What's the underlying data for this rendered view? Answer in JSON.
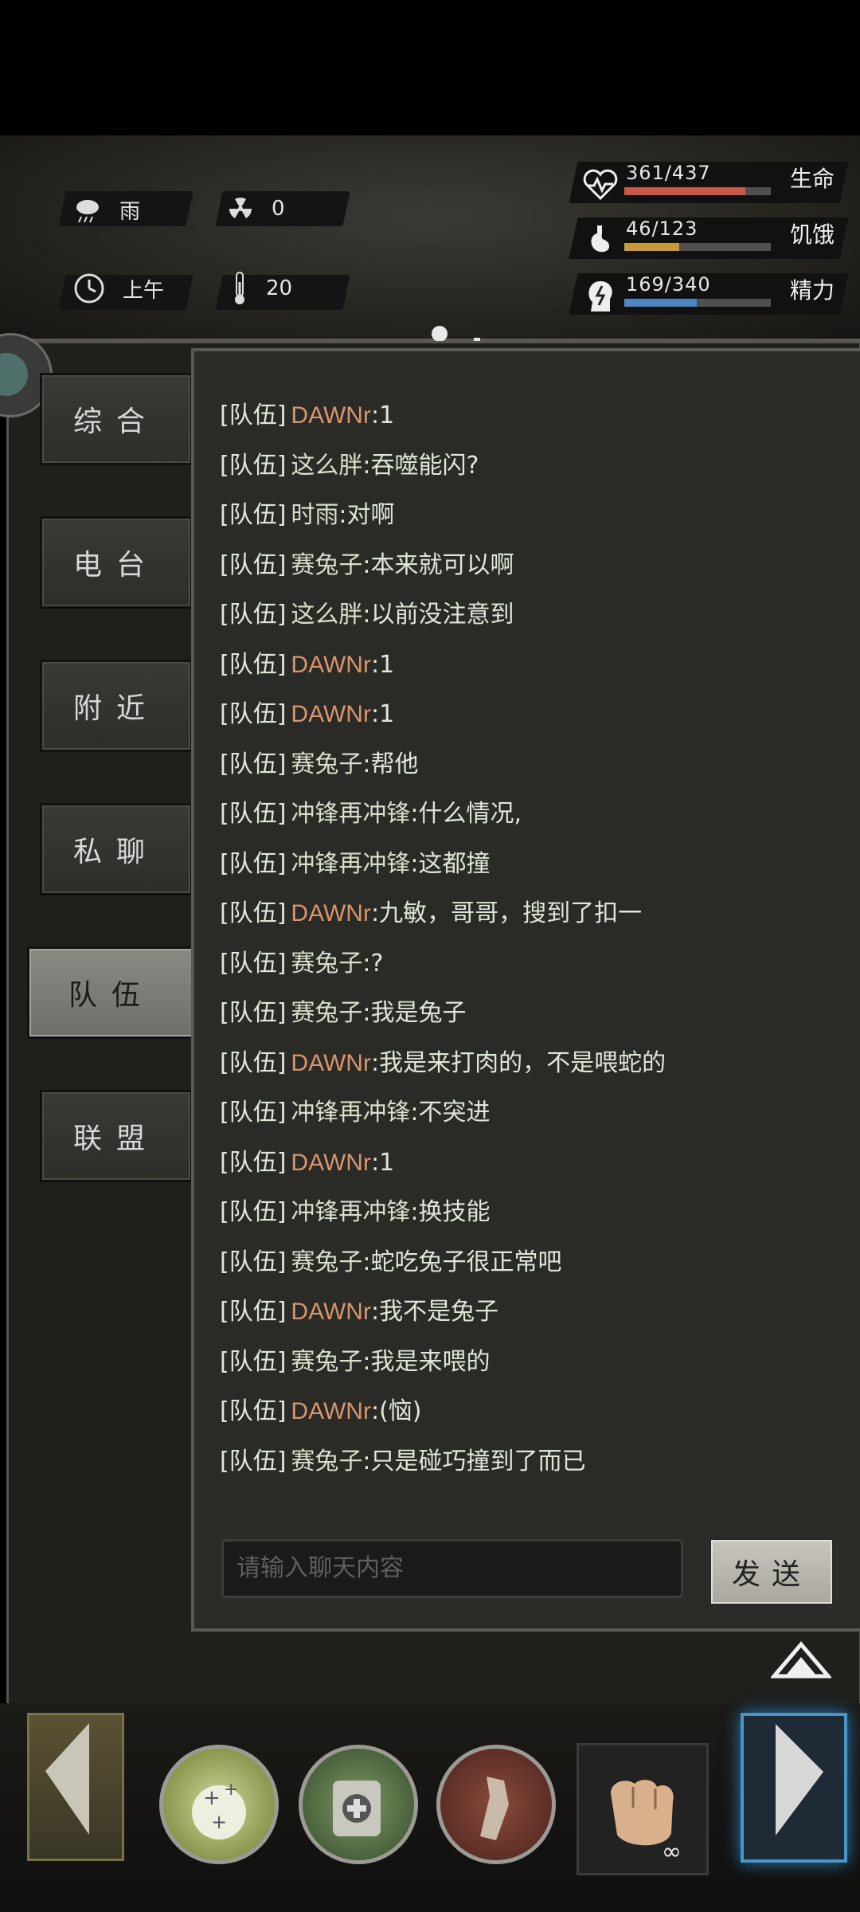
{
  "status": {
    "weather": "雨",
    "radiation": "0",
    "time_of_day": "上午",
    "temperature": "20"
  },
  "stats": [
    {
      "label": "生命",
      "value_text": "361/437",
      "current": 361,
      "max": 437,
      "color": "#c85a48",
      "icon": "heart-pulse-icon"
    },
    {
      "label": "饥饿",
      "value_text": "46/123",
      "current": 46,
      "max": 123,
      "color": "#c99a3a",
      "icon": "stomach-icon"
    },
    {
      "label": "精力",
      "value_text": "169/340",
      "current": 169,
      "max": 340,
      "color": "#4d86c2",
      "icon": "head-energy-icon"
    }
  ],
  "tabs": [
    {
      "label": "综合",
      "active": false
    },
    {
      "label": "电台",
      "active": false
    },
    {
      "label": "附近",
      "active": false
    },
    {
      "label": "私聊",
      "active": false
    },
    {
      "label": "队伍",
      "active": true
    },
    {
      "label": "联盟",
      "active": false
    }
  ],
  "messages": [
    {
      "tag": "[队伍]",
      "name": "DAWNr",
      "text": ":1"
    },
    {
      "tag": "[队伍]",
      "name": "这么胖",
      "text": ":吞噬能闪?"
    },
    {
      "tag": "[队伍]",
      "name": "时雨",
      "text": ":对啊"
    },
    {
      "tag": "[队伍]",
      "name": "赛兔子",
      "text": ":本来就可以啊"
    },
    {
      "tag": "[队伍]",
      "name": "这么胖",
      "text": ":以前没注意到"
    },
    {
      "tag": "[队伍]",
      "name": "DAWNr",
      "text": ":1"
    },
    {
      "tag": "[队伍]",
      "name": "DAWNr",
      "text": ":1"
    },
    {
      "tag": "[队伍]",
      "name": "赛兔子",
      "text": ":帮他"
    },
    {
      "tag": "[队伍]",
      "name": "冲锋再冲锋",
      "text": ":什么情况,"
    },
    {
      "tag": "[队伍]",
      "name": "冲锋再冲锋",
      "text": ":这都撞"
    },
    {
      "tag": "[队伍]",
      "name": "DAWNr",
      "text": ":九敏，哥哥，搜到了扣一"
    },
    {
      "tag": "[队伍]",
      "name": "赛兔子",
      "text": ":?"
    },
    {
      "tag": "[队伍]",
      "name": "赛兔子",
      "text": ":我是兔子"
    },
    {
      "tag": "[队伍]",
      "name": "DAWNr",
      "text": ":我是来打肉的，不是喂蛇的"
    },
    {
      "tag": "[队伍]",
      "name": "冲锋再冲锋",
      "text": ":不突进"
    },
    {
      "tag": "[队伍]",
      "name": "DAWNr",
      "text": ":1"
    },
    {
      "tag": "[队伍]",
      "name": "冲锋再冲锋",
      "text": ":换技能"
    },
    {
      "tag": "[队伍]",
      "name": "赛兔子",
      "text": ":蛇吃兔子很正常吧"
    },
    {
      "tag": "[队伍]",
      "name": "DAWNr",
      "text": ":我不是兔子"
    },
    {
      "tag": "[队伍]",
      "name": "赛兔子",
      "text": ":我是来喂的"
    },
    {
      "tag": "[队伍]",
      "name": "DAWNr",
      "text": ":(恼)"
    },
    {
      "tag": "[队伍]",
      "name": "赛兔子",
      "text": ":只是碰巧撞到了而已"
    }
  ],
  "chat_input": {
    "placeholder": "请输入聊天内容"
  },
  "send_label": "发送",
  "fist_count": "∞"
}
